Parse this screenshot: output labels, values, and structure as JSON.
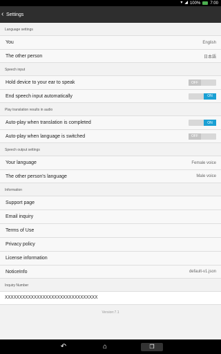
{
  "status_bar": {
    "battery": "100%",
    "time": "7:00"
  },
  "app_bar": {
    "title": "Settings"
  },
  "sections": {
    "language": {
      "header": "Language settings",
      "rows": [
        {
          "label": "You",
          "value": "English"
        },
        {
          "label": "The other person",
          "value": "日本語"
        }
      ]
    },
    "speech_input": {
      "header": "Speech input",
      "rows": [
        {
          "label": "Hold device to your ear to speak",
          "toggle": "OFF"
        },
        {
          "label": "End speech input automatically",
          "toggle": "ON"
        }
      ]
    },
    "play_translation": {
      "header": "Play translation results in audio",
      "rows": [
        {
          "label": "Auto-play when translation is completed",
          "toggle": "ON"
        },
        {
          "label": "Auto-play when language is switched",
          "toggle": "OFF"
        }
      ]
    },
    "speech_output": {
      "header": "Speech output settings",
      "rows": [
        {
          "label": "Your language",
          "value": "Female voice"
        },
        {
          "label": "The other person's language",
          "value": "Male voice"
        }
      ]
    },
    "information": {
      "header": "Information",
      "rows": [
        {
          "label": "Support page"
        },
        {
          "label": "Email inquiry"
        },
        {
          "label": "Terms of Use"
        },
        {
          "label": "Privacy policy"
        },
        {
          "label": "License information"
        },
        {
          "label": "NoticeInfo",
          "value": "default-v1.json"
        }
      ]
    },
    "inquiry": {
      "header": "Inquiry Number",
      "value": "XXXXXXXXXXXXXXXXXXXXXXXXXXXXXXXX"
    }
  },
  "version": "Version:7.1"
}
